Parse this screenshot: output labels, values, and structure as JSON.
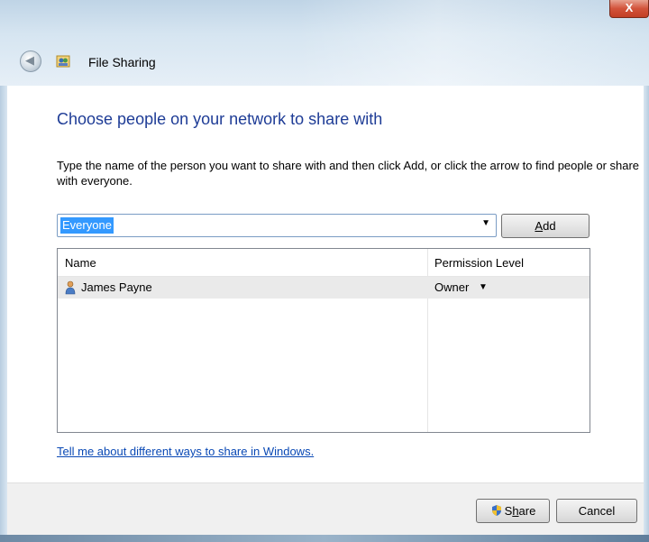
{
  "window": {
    "title": "File Sharing",
    "close_label": "X"
  },
  "icons": {
    "back": "back-arrow-icon",
    "app": "file-sharing-icon",
    "user": "user-icon",
    "shield": "uac-shield-icon"
  },
  "main": {
    "heading": "Choose people on your network to share with",
    "instructions": "Type the name of the person you want to share with and then click Add, or click the arrow to find people or share with everyone.",
    "combo_value": "Everyone",
    "add_label_pre": "",
    "add_label_key": "A",
    "add_label_post": "dd",
    "list": {
      "columns": [
        "Name",
        "Permission Level"
      ],
      "rows": [
        {
          "name": "James Payne",
          "permission": "Owner"
        }
      ]
    },
    "help_link": "Tell me about different ways to share in Windows."
  },
  "footer": {
    "share_pre": "S",
    "share_key": "h",
    "share_post": "are",
    "cancel_label": "Cancel"
  },
  "colors": {
    "heading": "#1e3c96",
    "link": "#0a49b5",
    "selection": "#3399ff"
  }
}
